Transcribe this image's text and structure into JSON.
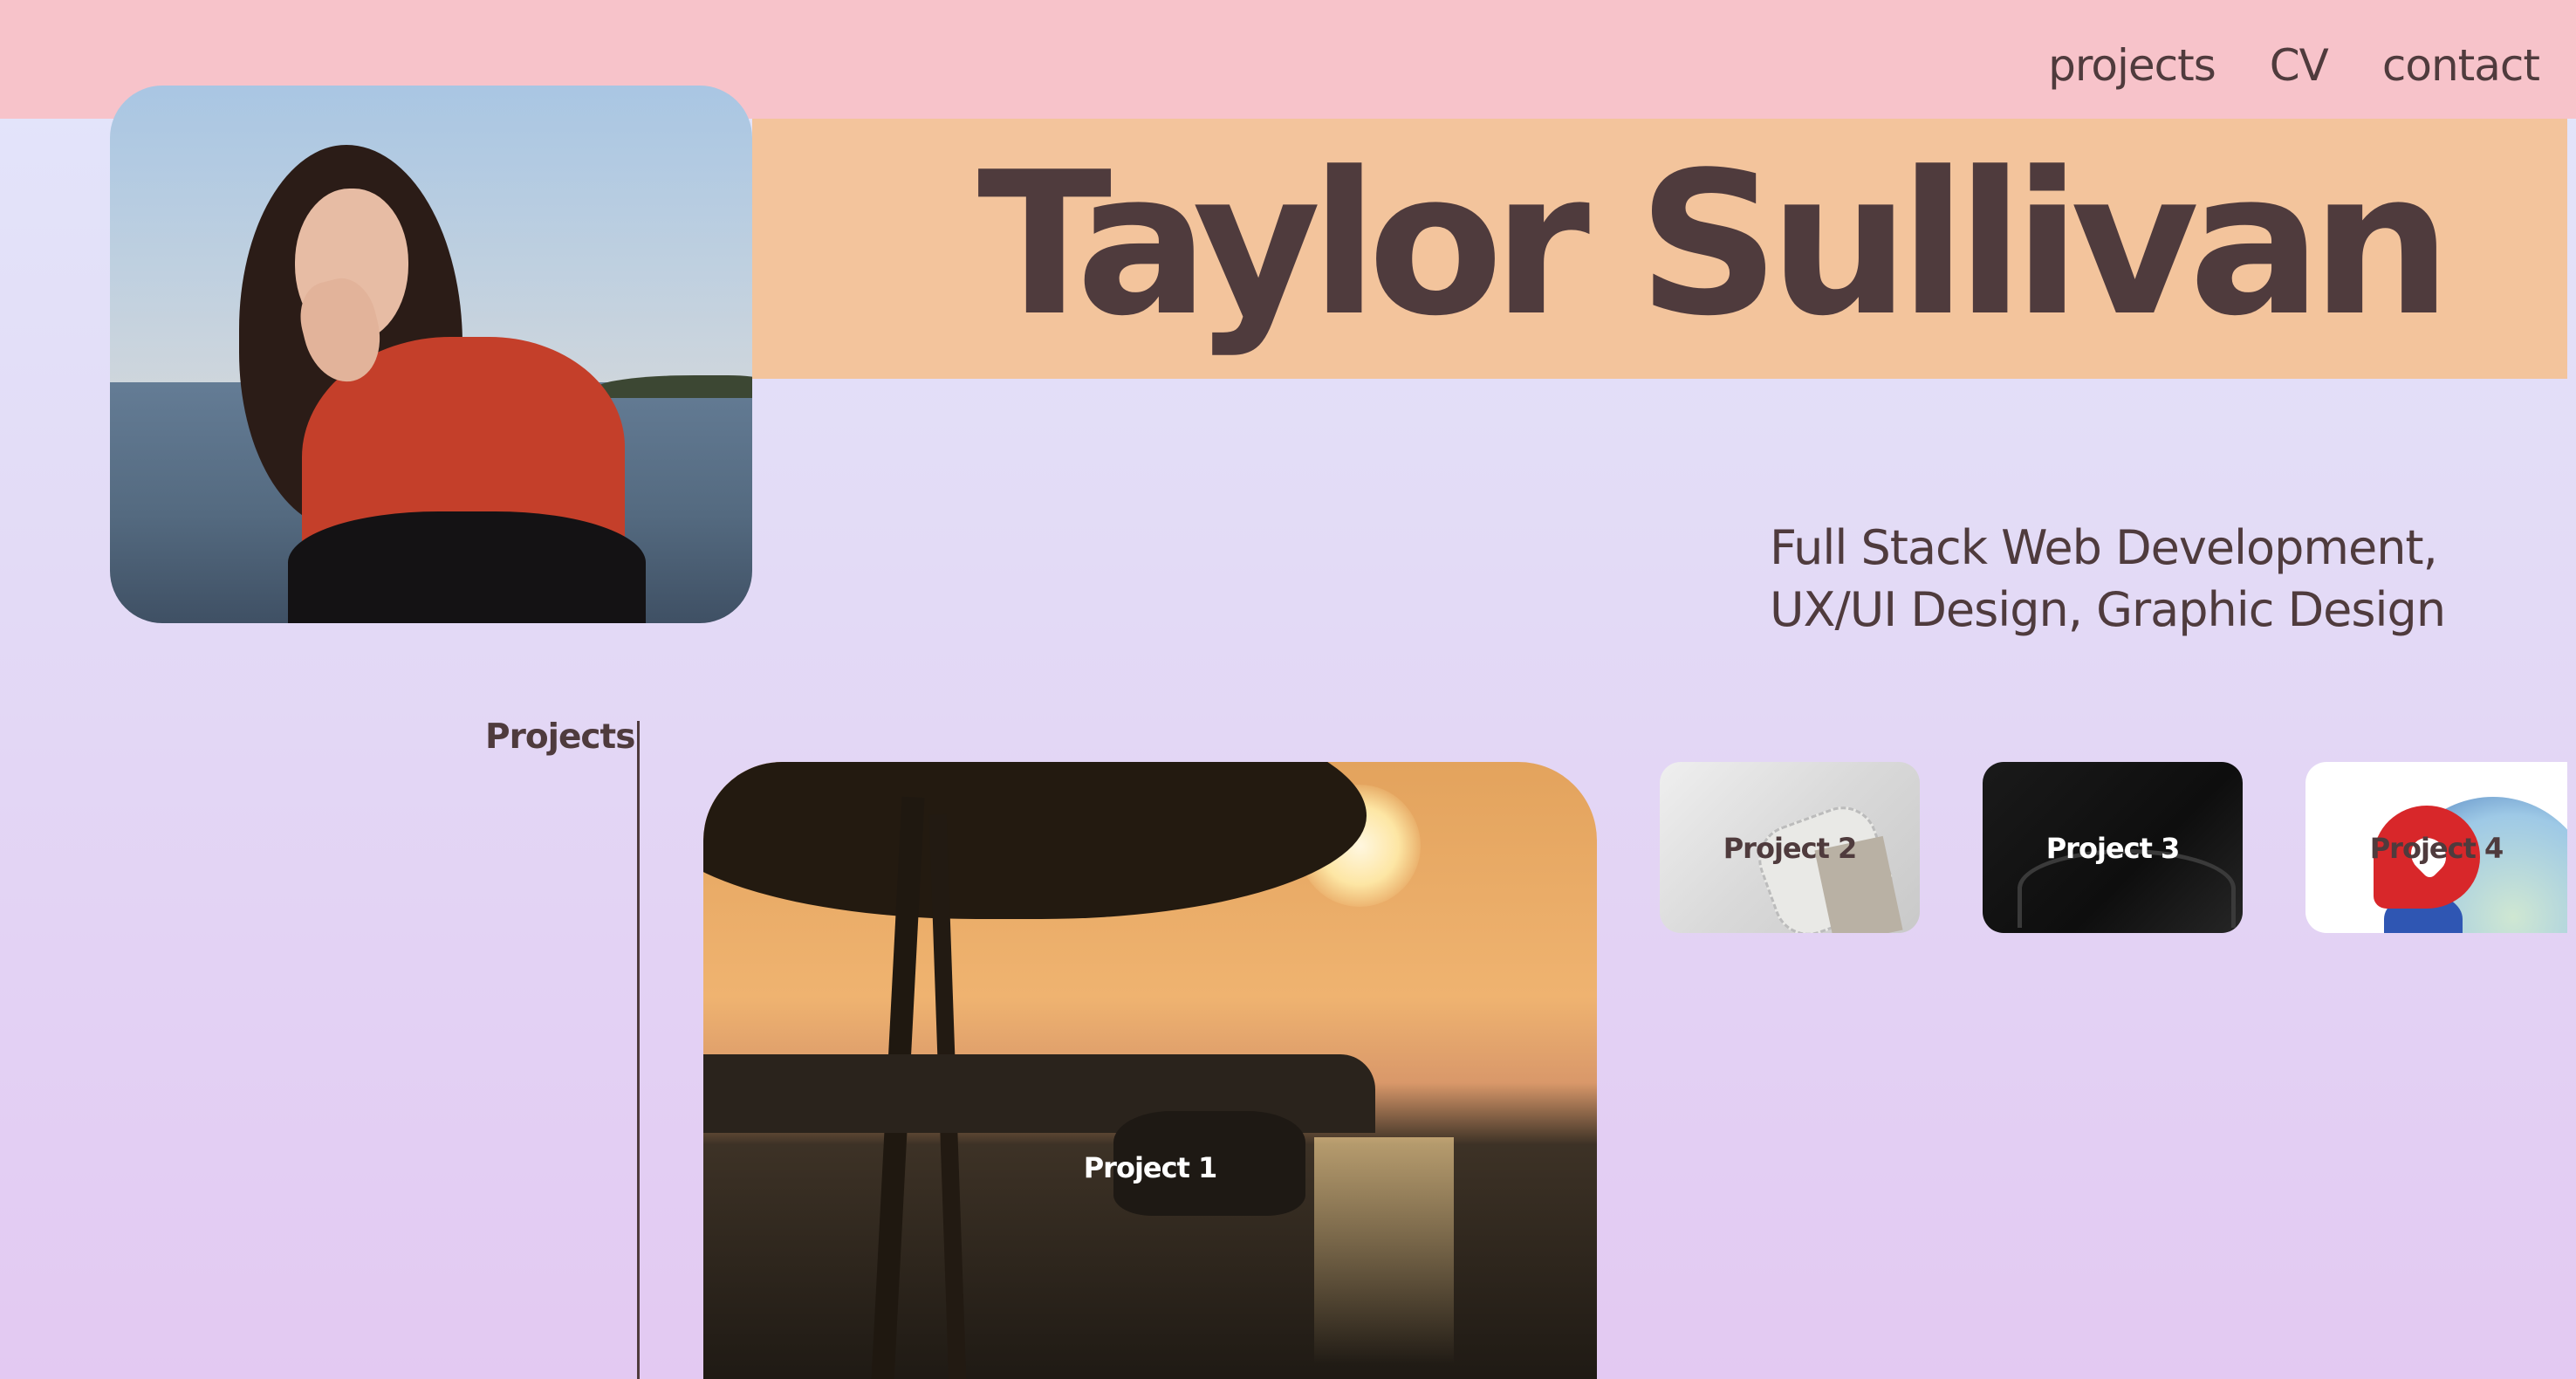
{
  "nav": {
    "items": [
      {
        "label": "projects"
      },
      {
        "label": "CV"
      },
      {
        "label": "contact"
      }
    ]
  },
  "header": {
    "title": "Taylor Sullivan"
  },
  "intro": {
    "subtitle": "Full Stack Web Development, UX/UI Design, Graphic Design"
  },
  "projects": {
    "heading": "Projects",
    "cards": [
      {
        "label": "Project 1"
      },
      {
        "label": "Project 2"
      },
      {
        "label": "Project 3"
      },
      {
        "label": "Project 4"
      }
    ]
  },
  "colors": {
    "top_bar": "#f7c3ca",
    "title_band": "#f3c49c",
    "text": "#4f3b3d",
    "background_top": "#e3e6fb",
    "background_bottom": "#e3c9f2"
  }
}
